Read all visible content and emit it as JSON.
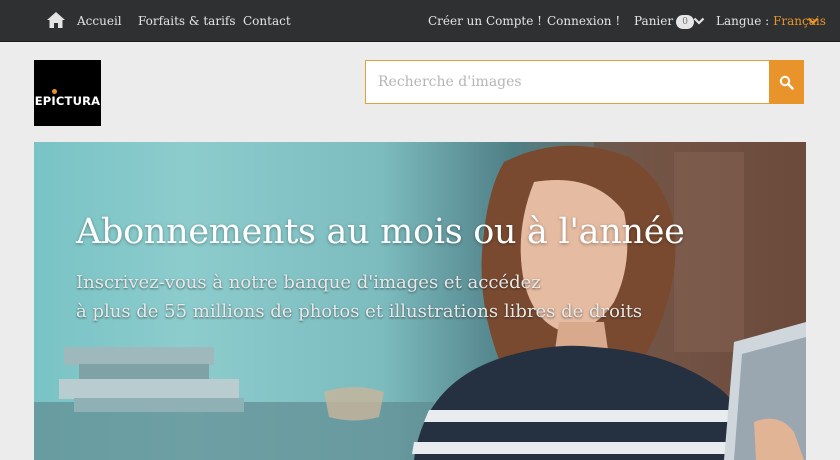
{
  "nav": {
    "home_label": "Accueil",
    "pricing_label": "Forfaits & tarifs",
    "contact_label": "Contact",
    "signup_label": "Créer un Compte !",
    "login_label": "Connexion !",
    "cart_label": "Panier",
    "cart_count": "0",
    "language_label": "Langue :",
    "language_value": "Français"
  },
  "brand": {
    "logo_text": "EPICTURA"
  },
  "search": {
    "placeholder": "Recherche d'images",
    "value": ""
  },
  "hero": {
    "title": "Abonnements au mois ou à l'année",
    "subtitle_line1": "Inscrivez-vous à notre banque d'images et accédez",
    "subtitle_line2": "à plus de 55 millions de photos et illustrations libres de droits"
  },
  "colors": {
    "accent": "#e8942a",
    "topbar": "#2f3031",
    "page_bg": "#ececec"
  },
  "icons": {
    "home": "home-icon",
    "search": "search-icon",
    "cart_chevron": "chevron-down-icon",
    "language_chevron": "chevron-down-icon"
  }
}
